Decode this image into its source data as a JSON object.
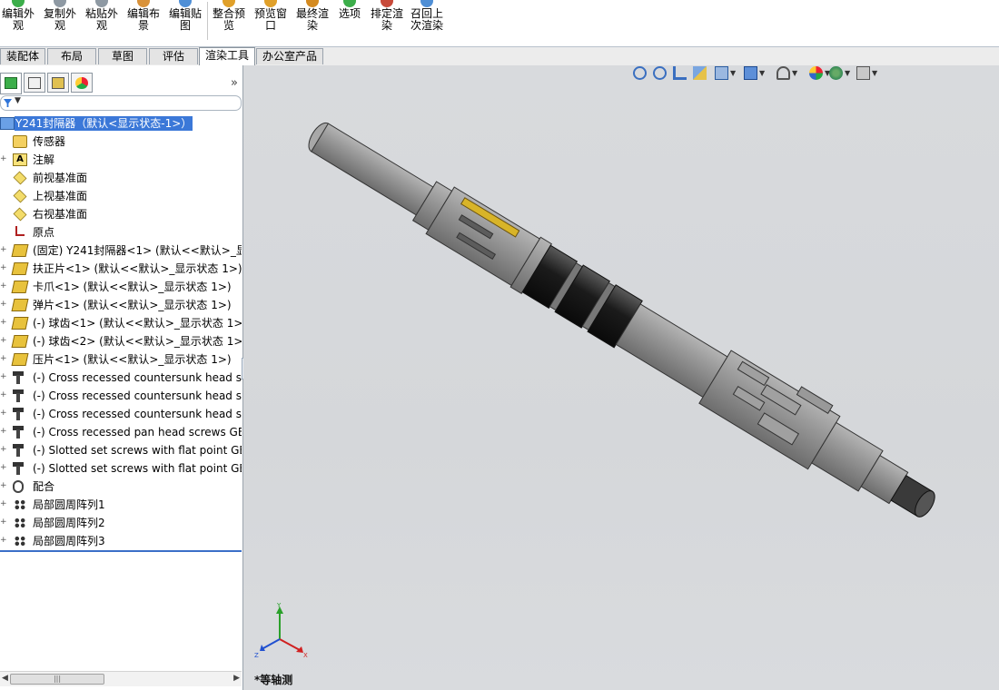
{
  "ribbon": {
    "buttons": [
      {
        "label": "编辑外\n观",
        "color": "#3cae4a"
      },
      {
        "label": "复制外\n观",
        "color": "#8e99a3"
      },
      {
        "label": "粘贴外\n观",
        "color": "#8e99a3"
      },
      {
        "label": "编辑布\n景",
        "color": "#d9923a"
      },
      {
        "label": "编辑贴\n图",
        "color": "#4f8fd6"
      },
      {
        "label": "整合预\n览",
        "color": "#e0a02a"
      },
      {
        "label": "预览窗\n口",
        "color": "#e0a02a"
      },
      {
        "label": "最终渲\n染",
        "color": "#d48a20"
      },
      {
        "label": "选项",
        "color": "#3cae4a"
      },
      {
        "label": "排定渲\n染",
        "color": "#c84a3a"
      },
      {
        "label": "召回上\n次渲染",
        "color": "#4f8fd6"
      }
    ]
  },
  "tabs": [
    "装配体",
    "布局",
    "草图",
    "评估",
    "渲染工具",
    "办公室产品"
  ],
  "active_tab": "渲染工具",
  "tree": {
    "root": "Y241封隔器（默认<显示状态-1>）",
    "items": [
      {
        "label": "传感器",
        "icon": "sensor-icon"
      },
      {
        "label": "注解",
        "icon": "annotation-icon"
      },
      {
        "label": "前视基准面",
        "icon": "plane-icon"
      },
      {
        "label": "上视基准面",
        "icon": "plane-icon"
      },
      {
        "label": "右视基准面",
        "icon": "plane-icon"
      },
      {
        "label": "原点",
        "icon": "origin-icon"
      },
      {
        "label": "(固定) Y241封隔器<1> (默认<<默认>_显示",
        "icon": "part-icon"
      },
      {
        "label": "扶正片<1> (默认<<默认>_显示状态 1>)",
        "icon": "part-icon"
      },
      {
        "label": "卡爪<1> (默认<<默认>_显示状态 1>)",
        "icon": "part-icon"
      },
      {
        "label": "弹片<1> (默认<<默认>_显示状态 1>)",
        "icon": "part-icon"
      },
      {
        "label": "(-) 球齿<1> (默认<<默认>_显示状态 1>)",
        "icon": "part-icon"
      },
      {
        "label": "(-) 球齿<2> (默认<<默认>_显示状态 1>)",
        "icon": "part-icon"
      },
      {
        "label": "压片<1> (默认<<默认>_显示状态 1>)",
        "icon": "part-icon"
      },
      {
        "label": "(-) Cross recessed countersunk head sc",
        "icon": "screw-icon"
      },
      {
        "label": "(-) Cross recessed countersunk head sc",
        "icon": "screw-icon"
      },
      {
        "label": "(-) Cross recessed countersunk head sc",
        "icon": "screw-icon"
      },
      {
        "label": "(-) Cross recessed pan head screws GB",
        "icon": "screw-icon"
      },
      {
        "label": "(-) Slotted set screws with flat point GB-",
        "icon": "screw-icon"
      },
      {
        "label": "(-) Slotted set screws with flat point GB-",
        "icon": "screw-icon"
      },
      {
        "label": "配合",
        "icon": "mate-icon"
      },
      {
        "label": "局部圆周阵列1",
        "icon": "pattern-icon"
      },
      {
        "label": "局部圆周阵列2",
        "icon": "pattern-icon"
      },
      {
        "label": "局部圆周阵列3",
        "icon": "pattern-icon"
      }
    ]
  },
  "viewport": {
    "view_name": "*等轴测",
    "triad": {
      "x": "X",
      "y": "Y",
      "z": "Z"
    },
    "toolbar_icons": [
      "zoom-to-fit-icon",
      "zoom-area-icon",
      "previous-view-icon",
      "section-view-icon",
      "view-orientation-icon",
      "display-style-icon",
      "hide-show-icon",
      "appearance-icon",
      "scene-icon",
      "view-settings-icon"
    ]
  },
  "colors": {
    "accent": "#3b78d8",
    "viewport_bg": "#d7d9dc",
    "model_body": "#8c8c8c",
    "model_dark": "#1a1a1a"
  }
}
